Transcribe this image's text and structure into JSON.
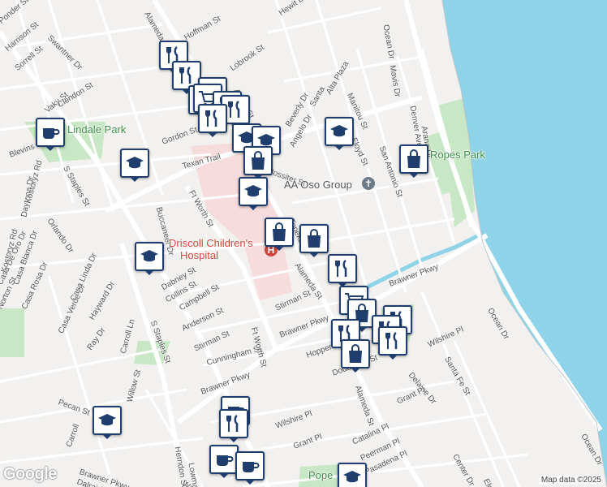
{
  "map": {
    "colors": {
      "water": "#8fd3e8",
      "park": "#c7e7c5",
      "hospital_area": "#f6dcdc",
      "road": "#ffffff",
      "minor_road": "#ffffff",
      "building": "#ebe9e6"
    },
    "attribution": "Map data ©2025",
    "logo": "Google",
    "pois": {
      "hospital": [
        "Driscoll Children's",
        "Hospital"
      ],
      "lindale_park": "Lindale Park",
      "ropes_park": "Ropes Park",
      "aa_group": "AA Oso Group",
      "pope": "Pope"
    },
    "streets": [
      "Ponder St",
      "Harrison St",
      "Swantner Dr",
      "Sorrell St",
      "Vaky St",
      "Clendon St",
      "Blevins St",
      "Daytona Dr",
      "Kostoryz Rd",
      "S Staples St",
      "Orlando Dr",
      "Kostoryz Rd",
      "Casa De Oro Dr",
      "Casa Blanca Dr",
      "Casa Rosa Dr",
      "Casa Verde Dr",
      "Casa Linda Dr",
      "Hayward Dr",
      "Ray Dr",
      "Carroll Ln",
      "S Staples St",
      "Norton St",
      "Dabney St",
      "Collins St",
      "Campbell St",
      "Anderson St",
      "Stirman St",
      "Cunningham St",
      "Ft Worth St",
      "Ft Worth St",
      "Buccaneer Dr",
      "Texan Trail",
      "Gordon St",
      "Austin St",
      "Hoffman St",
      "Hewit Dr",
      "Alameda St",
      "Lobrook St",
      "Beverly Dr",
      "Angelo Dr",
      "Alta Plaza",
      "Rossiter St",
      "Manitou St",
      "Floyd St",
      "San Antonio St",
      "Mavis Dr",
      "Denver Ave",
      "Arana Dr",
      "Ocean Dr",
      "Santa",
      "Topeka St",
      "Alameda St",
      "Stirman St",
      "Brawner Pkwy",
      "Brawner Pkwy",
      "Brawner Pkwy",
      "Hopper",
      "Doddridge St",
      "Alameda St",
      "Delaine Dr",
      "Wilshire Pl",
      "Santa Fe St",
      "Grant Pl",
      "Catalina Pl",
      "Peerman Pl",
      "Pasadena Pl",
      "Center Dr",
      "Pecan St",
      "Willow St",
      "Herndon St",
      "Lowman St",
      "Wasser",
      "Dalraida Dr",
      "Brawner Pkwy",
      "Ocean Dr",
      "Ocean Dr",
      "Grant Pl",
      "Wilshire Pl",
      "Carroll",
      "Elgin"
    ],
    "markers": [
      "restaurant",
      "restaurant",
      "restaurant",
      "shopping-cart",
      "shopping-cart",
      "restaurant",
      "restaurant",
      "restaurant",
      "school",
      "school",
      "school",
      "cafe",
      "school",
      "shopping-bag",
      "school",
      "shopping-bag",
      "shopping-bag",
      "shopping-bag",
      "school",
      "restaurant",
      "shopping-cart",
      "shopping-bag",
      "restaurant",
      "restaurant",
      "restaurant",
      "restaurant",
      "shopping-bag",
      "school",
      "cafe",
      "restaurant",
      "cafe",
      "cafe",
      "school"
    ]
  }
}
